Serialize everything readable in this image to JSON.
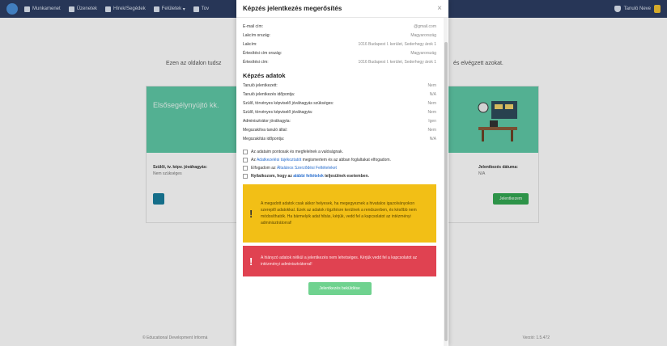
{
  "nav": {
    "items": [
      {
        "label": "Munkamenet",
        "icon": "home-icon"
      },
      {
        "label": "Üzenetek",
        "icon": "messages-icon"
      },
      {
        "label": "Hírek/Segédek",
        "icon": "news-icon"
      },
      {
        "label": "Felületek",
        "icon": "tiles-icon"
      },
      {
        "label": "Tov",
        "icon": "more-icon"
      }
    ],
    "user_name": "Tanuló Neve"
  },
  "backdrop": {
    "intro_left": "Ezen az oldalon tudsz",
    "intro_right": "és elvégzett azokat.",
    "banner_title": "Elsősegélynyújtó kk.",
    "field1_label": "Szülői, tv. képv. jóváhagyás:",
    "field1_value": "Nem szükséges",
    "field2_label": "Jelentkezés dátuma:",
    "field2_value": "N/A",
    "apply_label": "Jelentkezem",
    "footer_left": "© Educational Development Informá",
    "footer_right": "Verzió: 1.5.472"
  },
  "modal": {
    "title": "Képzés jelentkezés megerősítés",
    "personal_rows": [
      {
        "label": "E-mail cím:",
        "value": "@gmail.com"
      },
      {
        "label": "Lakcím ország:",
        "value": "Magyarország"
      },
      {
        "label": "Lakcím:",
        "value": "1016 Budapest I. kerület, Sederhegy árok 1"
      },
      {
        "label": "Értesítési cím ország:",
        "value": "Magyarország"
      },
      {
        "label": "Értesítési cím:",
        "value": "1016 Budapest I. kerület, Sederhegy árok 1"
      }
    ],
    "training_title": "Képzés adatok",
    "training_rows": [
      {
        "label": "Tanuló jelentkezett:",
        "value": "Nem"
      },
      {
        "label": "Tanuló jelentkezés időpontja:",
        "value": "N/A"
      },
      {
        "label": "Szülő, törvényes képviselő jóváhagyás szükséges:",
        "value": "Nem"
      },
      {
        "label": "Szülő, törvényes képviselő jóváhagyta:",
        "value": "Nem"
      },
      {
        "label": "Adminisztrátor jóváhagyta:",
        "value": "Igen"
      },
      {
        "label": "Megszakítva tanuló által:",
        "value": "Nem"
      },
      {
        "label": "Megszakítás időpontja:",
        "value": "N/A"
      }
    ],
    "check1": "Az adataim pontosak és megfelelnek a valóságnak.",
    "check2_pre": "Az",
    "check2_link": "Adatkezelési tájékoztatót",
    "check2_post": "megismertem és az abban foglaltakat elfogadom.",
    "check3_pre": "Elfogadom az",
    "check3_link": "Általános Szerződési Feltételeket",
    "check4_pre": "Nyilatkozom, hogy az",
    "check4_link": "alábbi feltételek",
    "check4_post": "teljesülnek esetemben.",
    "warning_text": "A megadott adatok csak akkor helyesek, ha megegyeznek a hivatalos igazolványokon szereplő adatokkal. Ezek az adatok rögzítésre kerülnek a rendszerben, és később nem módosíthatók. Ha bármelyik adat hibás, kérjük, vedd fel a kapcsolatot az intézményi adminisztrátorral!",
    "danger_text": "A hiányzó adatok nélkül a jelentkezés nem lehetséges. Kérjük vedd fel a kapcsolatot az intézményi adminisztrátorral!",
    "submit_label": "Jelentkezés beküldése"
  },
  "colors": {
    "navbar": "#2d3e63",
    "banner": "#5fc9a7",
    "warning": "#f2bf16",
    "danger": "#e04251",
    "submit": "#6fd28f"
  }
}
